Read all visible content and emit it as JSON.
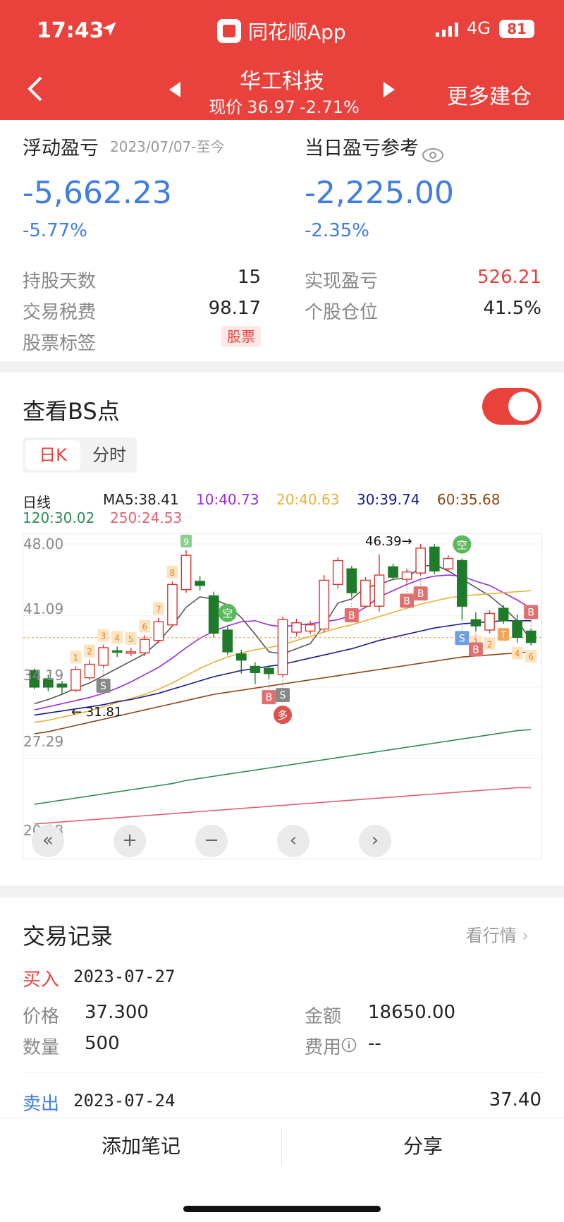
{
  "status": {
    "time": "17:43",
    "app_name": "同花顺App",
    "network": "4G",
    "battery": "81"
  },
  "header": {
    "stock_name": "华工科技",
    "price_label": "现价",
    "price": "36.97",
    "change": "-2.71%",
    "more_label": "更多建仓"
  },
  "summary": {
    "float_label": "浮动盈亏",
    "float_date": "2023/07/07-至今",
    "float_value": "-5,662.23",
    "float_pct": "-5.77%",
    "day_label": "当日盈亏参考",
    "day_value": "-2,225.00",
    "day_pct": "-2.35%",
    "rows_left": [
      {
        "label": "持股天数",
        "value": "15"
      },
      {
        "label": "交易税费",
        "value": "98.17"
      },
      {
        "label": "股票标签",
        "value": "股票"
      }
    ],
    "rows_right": [
      {
        "label": "实现盈亏",
        "value": "526.21"
      },
      {
        "label": "个股仓位",
        "value": "41.5%"
      }
    ]
  },
  "bs": {
    "title": "查看BS点",
    "tabs": [
      "日K",
      "分时"
    ],
    "ma_legend": [
      {
        "text": "日线",
        "color": "#333333"
      },
      {
        "text": "MA5:38.41",
        "color": "#333333"
      },
      {
        "text": "10:40.73",
        "color": "#9b2bdc"
      },
      {
        "text": "20:40.63",
        "color": "#e8b035"
      },
      {
        "text": "30:39.74",
        "color": "#1a1a8c"
      },
      {
        "text": "60:35.68",
        "color": "#8b4513"
      },
      {
        "text": "120:30.02",
        "color": "#2e8b57"
      },
      {
        "text": "250:24.53",
        "color": "#e06070"
      }
    ]
  },
  "chart_data": {
    "type": "candlestick",
    "y_ticks": [
      "48.00",
      "41.09",
      "34.19",
      "27.29",
      "20.38"
    ],
    "ylim": [
      20.38,
      48.0
    ],
    "annotations": {
      "high": "46.39→",
      "low": "← 31.81"
    },
    "current_price": 36.97,
    "candles": [
      [
        35.8,
        34.2,
        36.0,
        34.0
      ],
      [
        35.0,
        34.2,
        35.4,
        33.8
      ],
      [
        34.5,
        34.2,
        34.8,
        33.5
      ],
      [
        33.9,
        35.9,
        36.2,
        33.7
      ],
      [
        35.1,
        36.4,
        36.8,
        34.9
      ],
      [
        36.3,
        38.0,
        38.3,
        36.1
      ],
      [
        37.7,
        37.6,
        38.1,
        37.1
      ],
      [
        37.6,
        37.6,
        38.0,
        37.2
      ],
      [
        37.5,
        38.8,
        39.2,
        37.2
      ],
      [
        38.7,
        40.5,
        40.9,
        38.4
      ],
      [
        40.2,
        44.1,
        44.4,
        40.0
      ],
      [
        43.6,
        46.9,
        47.4,
        43.3
      ],
      [
        44.4,
        44.0,
        44.9,
        43.5
      ],
      [
        43.0,
        39.4,
        43.4,
        39.0
      ],
      [
        39.7,
        37.6,
        40.0,
        37.3
      ],
      [
        37.4,
        36.8,
        37.8,
        35.5
      ],
      [
        36.2,
        35.6,
        36.6,
        34.5
      ],
      [
        36.0,
        35.5,
        36.3,
        35.0
      ],
      [
        35.4,
        40.7,
        41.0,
        35.2
      ],
      [
        39.5,
        40.4,
        40.8,
        39.1
      ],
      [
        39.6,
        40.2,
        40.6,
        39.3
      ],
      [
        39.8,
        44.5,
        45.0,
        39.5
      ],
      [
        44.1,
        46.4,
        46.7,
        43.7
      ],
      [
        45.6,
        43.3,
        45.9,
        42.9
      ],
      [
        42.0,
        44.5,
        44.8,
        41.8
      ],
      [
        42.0,
        45.0,
        47.0,
        41.5
      ],
      [
        45.8,
        44.8,
        46.1,
        44.5
      ],
      [
        44.6,
        45.3,
        45.6,
        44.3
      ],
      [
        45.2,
        47.6,
        48.0,
        45.0
      ],
      [
        47.7,
        45.4,
        48.0,
        45.1
      ],
      [
        45.6,
        46.6,
        46.9,
        45.3
      ],
      [
        46.4,
        42.0,
        46.6,
        40.7
      ],
      [
        40.7,
        40.1,
        41.4,
        39.6
      ],
      [
        39.7,
        41.3,
        41.6,
        39.4
      ],
      [
        41.8,
        40.6,
        42.1,
        40.3
      ],
      [
        40.6,
        39.0,
        41.2,
        38.5
      ],
      [
        39.6,
        38.5,
        39.8,
        38.2
      ]
    ],
    "ma": {
      "MA5": [
        32.6,
        33.0,
        33.5,
        34.1,
        34.6,
        35.3,
        36.0,
        36.7,
        37.4,
        38.6,
        40.1,
        41.9,
        42.9,
        42.7,
        42.1,
        40.9,
        39.3,
        37.6,
        37.4,
        37.9,
        38.4,
        40.2,
        42.3,
        42.7,
        43.8,
        44.1,
        44.6,
        44.7,
        45.8,
        46.0,
        45.4,
        44.6,
        43.8,
        43.0,
        41.9,
        40.6,
        38.7
      ],
      "MA10": [
        32.0,
        32.3,
        32.6,
        32.9,
        33.2,
        33.6,
        34.1,
        34.7,
        35.4,
        36.1,
        37.0,
        38.0,
        38.9,
        39.6,
        40.1,
        40.5,
        40.6,
        40.2,
        40.0,
        40.2,
        40.3,
        40.5,
        40.7,
        41.1,
        41.9,
        42.9,
        43.5,
        44.1,
        44.6,
        44.9,
        45.0,
        44.9,
        44.4,
        44.0,
        43.3,
        42.6,
        41.8
      ],
      "MA20": [
        30.8,
        31.0,
        31.3,
        31.6,
        31.9,
        32.3,
        32.7,
        33.1,
        33.5,
        34.0,
        34.6,
        35.3,
        36.0,
        36.6,
        37.1,
        37.5,
        37.8,
        38.0,
        38.3,
        38.7,
        39.1,
        39.5,
        39.9,
        40.2,
        40.6,
        41.0,
        41.4,
        41.8,
        42.2,
        42.5,
        42.8,
        43.0,
        43.1,
        43.2,
        43.3,
        43.4,
        43.5
      ],
      "MA30": [
        31.5,
        31.7,
        31.9,
        32.1,
        32.3,
        32.5,
        32.8,
        33.0,
        33.3,
        33.6,
        34.0,
        34.4,
        34.8,
        35.2,
        35.5,
        35.8,
        36.0,
        36.2,
        36.4,
        36.7,
        37.0,
        37.3,
        37.6,
        37.9,
        38.3,
        38.7,
        39.0,
        39.3,
        39.6,
        39.9,
        40.1,
        40.3,
        40.4,
        40.5,
        40.6,
        40.6,
        40.6
      ],
      "MA60": [
        29.7,
        29.9,
        30.2,
        30.5,
        30.8,
        31.1,
        31.4,
        31.7,
        32.0,
        32.3,
        32.6,
        32.9,
        33.2,
        33.5,
        33.7,
        33.9,
        34.1,
        34.3,
        34.5,
        34.7,
        34.9,
        35.1,
        35.3,
        35.5,
        35.7,
        35.9,
        36.1,
        36.3,
        36.5,
        36.7,
        36.9,
        37.1,
        37.2,
        37.3,
        37.4,
        37.5,
        37.6
      ],
      "MA120": [
        22.9,
        23.1,
        23.3,
        23.5,
        23.7,
        23.9,
        24.1,
        24.3,
        24.5,
        24.7,
        24.9,
        25.2,
        25.4,
        25.6,
        25.8,
        26.0,
        26.2,
        26.4,
        26.6,
        26.8,
        27.0,
        27.2,
        27.4,
        27.6,
        27.8,
        28.0,
        28.2,
        28.4,
        28.6,
        28.8,
        29.0,
        29.2,
        29.4,
        29.6,
        29.8,
        30.0,
        30.1
      ],
      "MA250": [
        21.0,
        21.1,
        21.2,
        21.3,
        21.4,
        21.5,
        21.6,
        21.7,
        21.8,
        21.9,
        22.0,
        22.1,
        22.2,
        22.3,
        22.4,
        22.5,
        22.6,
        22.7,
        22.8,
        22.9,
        23.0,
        23.1,
        23.2,
        23.3,
        23.4,
        23.5,
        23.6,
        23.7,
        23.8,
        23.9,
        24.0,
        24.1,
        24.2,
        24.3,
        24.4,
        24.5,
        24.5
      ]
    },
    "markers": [
      {
        "i": 5,
        "label": "S",
        "kind": "S",
        "side": "below"
      },
      {
        "i": 17,
        "label": "B",
        "kind": "B",
        "side": "below"
      },
      {
        "i": 18,
        "label": "S",
        "kind": "S",
        "side": "below"
      },
      {
        "i": 18,
        "label": "多",
        "kind": "long",
        "side": "below"
      },
      {
        "i": 14,
        "label": "空",
        "kind": "short",
        "side": "above"
      },
      {
        "i": 23,
        "label": "B",
        "kind": "B",
        "side": "below"
      },
      {
        "i": 27,
        "label": "B",
        "kind": "B",
        "side": "below"
      },
      {
        "i": 28,
        "label": "B",
        "kind": "B",
        "side": "below"
      },
      {
        "i": 31,
        "label": "S",
        "kind": "Sb",
        "side": "below"
      },
      {
        "i": 31,
        "label": "空",
        "kind": "short",
        "side": "above"
      },
      {
        "i": 32,
        "label": "B",
        "kind": "B",
        "side": "below"
      },
      {
        "i": 36,
        "label": "B",
        "kind": "B",
        "side": "above"
      }
    ],
    "count_marks": [
      {
        "i": 3,
        "n": "1",
        "side": "above"
      },
      {
        "i": 4,
        "n": "2",
        "side": "above"
      },
      {
        "i": 5,
        "n": "3",
        "side": "above"
      },
      {
        "i": 6,
        "n": "4",
        "side": "above"
      },
      {
        "i": 7,
        "n": "5",
        "side": "above"
      },
      {
        "i": 8,
        "n": "6",
        "side": "above"
      },
      {
        "i": 9,
        "n": "7",
        "side": "above"
      },
      {
        "i": 10,
        "n": "8",
        "side": "above"
      },
      {
        "i": 11,
        "n": "9",
        "side": "above",
        "green": true
      },
      {
        "i": 32,
        "n": "1",
        "side": "below"
      },
      {
        "i": 33,
        "n": "2",
        "side": "below"
      },
      {
        "i": 34,
        "n": "3",
        "side": "below"
      },
      {
        "i": 35,
        "n": "4",
        "side": "below"
      },
      {
        "i": 36,
        "n": "5",
        "side": "below"
      },
      {
        "i": 36,
        "n": "6",
        "side": "below"
      },
      {
        "i": 34,
        "n": "T",
        "side": "below",
        "solid": true
      }
    ]
  },
  "trades": {
    "title": "交易记录",
    "more": "看行情",
    "items": [
      {
        "type": "买入",
        "date": "2023-07-27",
        "price_label": "价格",
        "price": "37.300",
        "amount_label": "金额",
        "amount": "18650.00",
        "qty_label": "数量",
        "qty": "500",
        "fee_label": "费用",
        "fee": "--"
      },
      {
        "type": "卖出",
        "date": "2023-07-24",
        "value": "37.40"
      }
    ]
  },
  "bottom": {
    "add_note": "添加笔记",
    "share": "分享"
  }
}
